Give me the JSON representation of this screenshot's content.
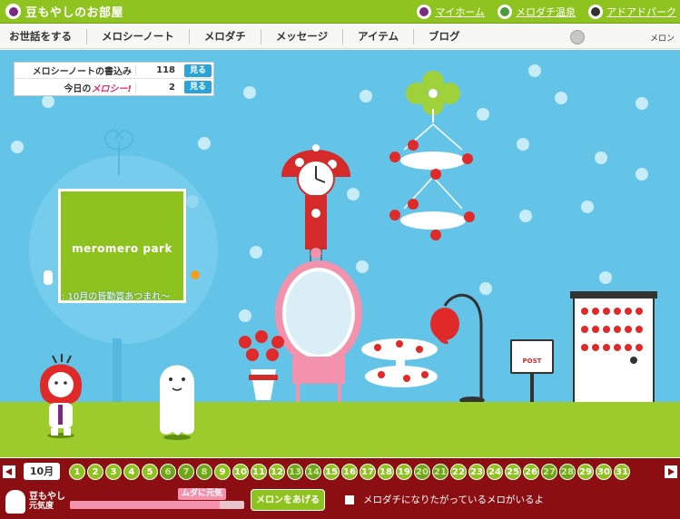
{
  "header": {
    "room_title": "豆もやしのお部屋",
    "links": [
      {
        "label": "マイホーム",
        "icon": "mushroom-icon",
        "color": "#7b2a7f"
      },
      {
        "label": "メロダチ温泉",
        "icon": "onsen-icon",
        "color": "#4a9a3a"
      },
      {
        "label": "アドアドパーク",
        "icon": "park-icon",
        "color": "#333333"
      }
    ]
  },
  "nav": {
    "items": [
      "お世話をする",
      "メロシーノート",
      "メロダチ",
      "メッセージ",
      "アイテム",
      "ブログ"
    ],
    "user_label": "メロン"
  },
  "counters": [
    {
      "label": "メロシーノートの書込み",
      "value": "118",
      "button": "見る"
    },
    {
      "label": "今日の",
      "label_suffix": "メロシー!",
      "value": "2",
      "button": "見る"
    }
  ],
  "board": {
    "brand": "meromero park",
    "news": ": 10月の皆勤賞あつまれ〜"
  },
  "post": {
    "label": "POST"
  },
  "calendar": {
    "month": "10月",
    "days": [
      "1",
      "2",
      "3",
      "4",
      "5",
      "6",
      "7",
      "8",
      "9",
      "10",
      "11",
      "12",
      "13",
      "14",
      "15",
      "16",
      "17",
      "18",
      "19",
      "20",
      "21",
      "22",
      "23",
      "24",
      "25",
      "26",
      "27",
      "28",
      "29",
      "30",
      "31"
    ],
    "muted_days": [
      "6",
      "7",
      "8",
      "13",
      "14",
      "20",
      "21",
      "27",
      "28"
    ]
  },
  "status": {
    "name": "豆もやし",
    "sub": "元気度",
    "mood_label": "ムダに元気",
    "mood_fill": 0.86,
    "feed_button": "メロンをあげる",
    "message": "メロダチになりたがっているメロがいるよ"
  },
  "colors": {
    "header_green": "#8fc31f",
    "sky_blue": "#63c4e8",
    "floor_green": "#9ccb2c",
    "calendar_red": "#8b0f12",
    "accent_pink": "#f392ad"
  }
}
